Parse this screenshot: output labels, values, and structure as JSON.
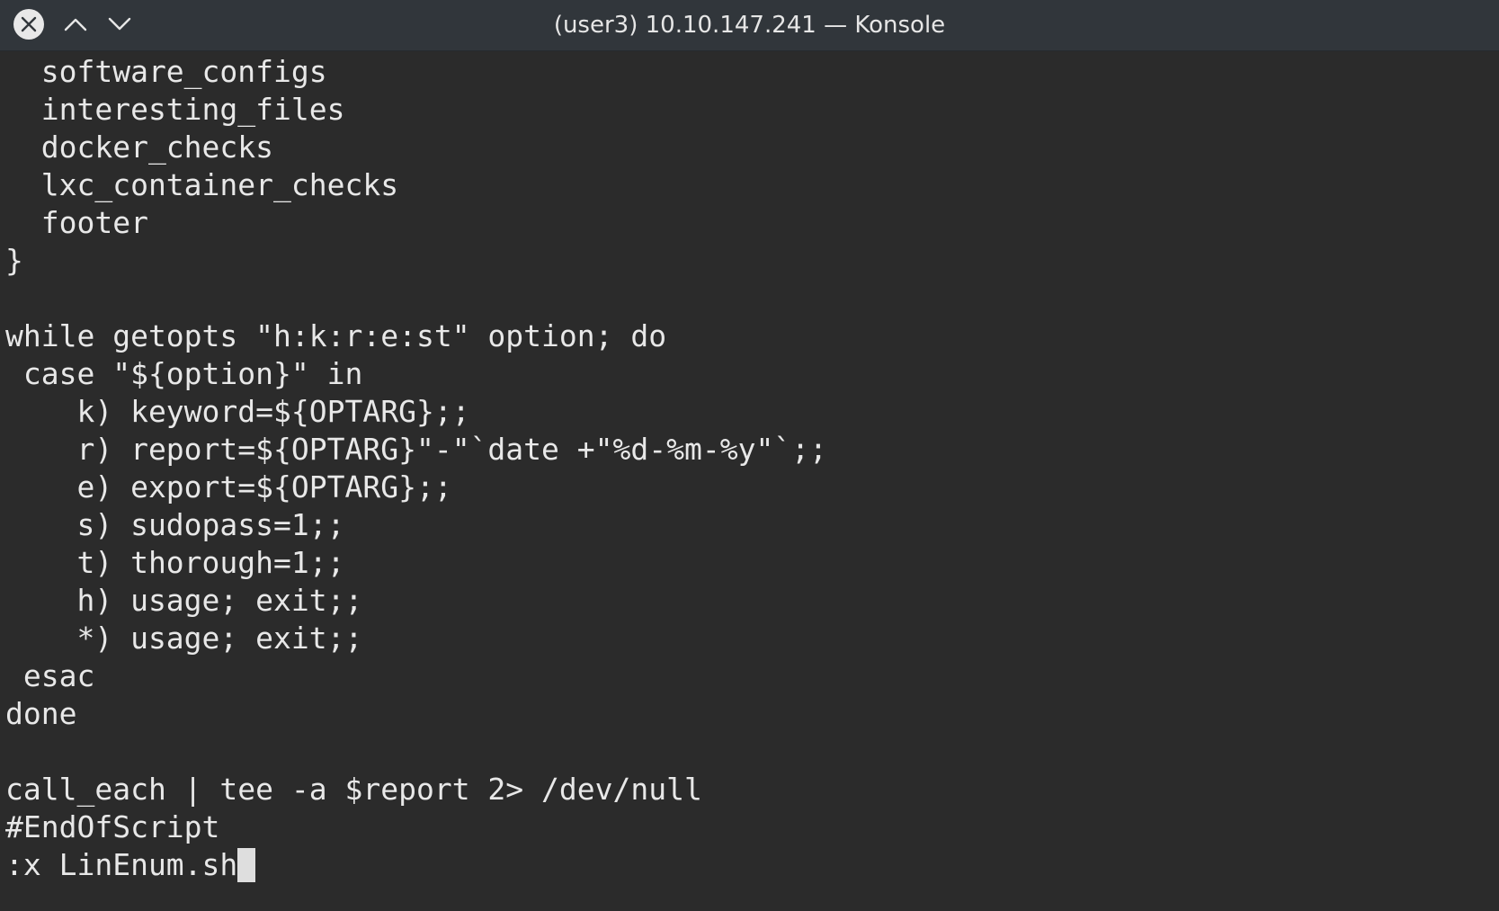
{
  "window": {
    "title": "(user3) 10.10.147.241 — Konsole",
    "close_icon": "close-icon",
    "up_icon": "chevron-up-icon",
    "down_icon": "chevron-down-icon"
  },
  "terminal": {
    "lines": [
      "  software_configs",
      "  interesting_files",
      "  docker_checks",
      "  lxc_container_checks",
      "  footer",
      "}",
      "",
      "while getopts \"h:k:r:e:st\" option; do",
      " case \"${option}\" in",
      "    k) keyword=${OPTARG};;",
      "    r) report=${OPTARG}\"-\"`date +\"%d-%m-%y\"`;;",
      "    e) export=${OPTARG};;",
      "    s) sudopass=1;;",
      "    t) thorough=1;;",
      "    h) usage; exit;;",
      "    *) usage; exit;;",
      " esac",
      "done",
      "",
      "call_each | tee -a $report 2> /dev/null",
      "#EndOfScript"
    ],
    "command_line": ":x LinEnum.sh"
  }
}
